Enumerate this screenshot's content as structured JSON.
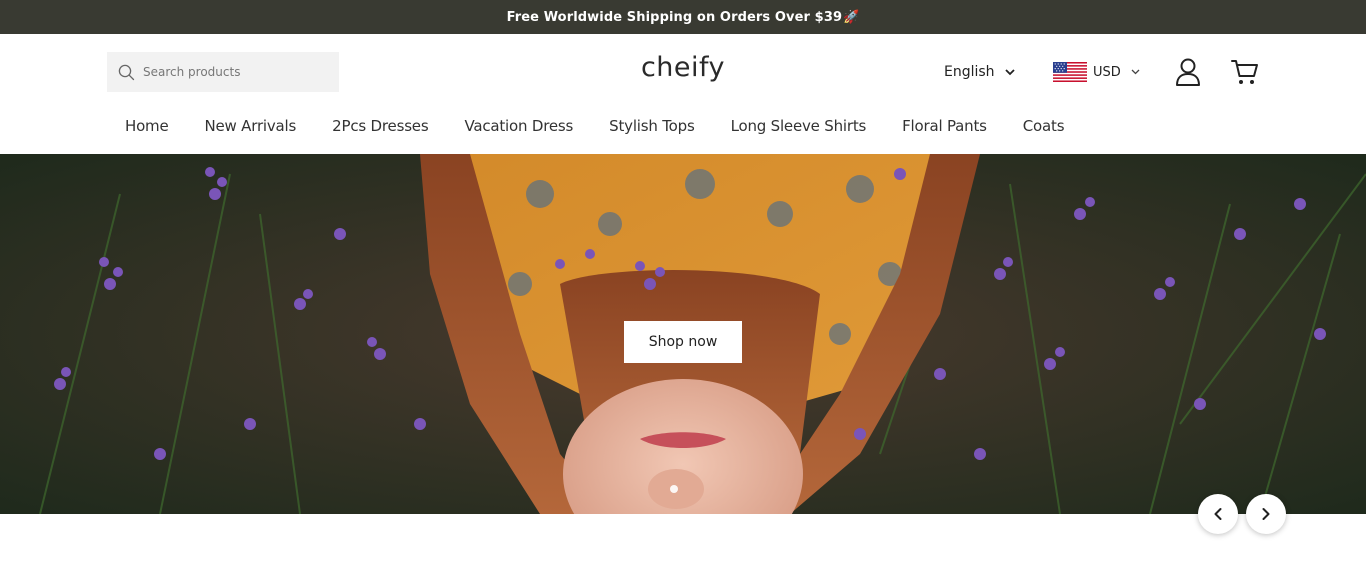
{
  "announcement": {
    "text": "Free Worldwide Shipping on Orders Over $39",
    "emoji": "🚀"
  },
  "header": {
    "search_placeholder": "Search products",
    "logo": "cheify",
    "language": "English",
    "currency": "USD"
  },
  "nav": {
    "items": [
      "Home",
      "New Arrivals",
      "2Pcs Dresses",
      "Vacation Dress",
      "Stylish Tops",
      "Long Sleeve Shirts",
      "Floral Pants",
      "Coats"
    ]
  },
  "hero": {
    "cta_label": "Shop now",
    "slide_count": 1,
    "active_slide": 1
  },
  "icons": {
    "search": "search-icon",
    "language_chevron": "chevron-down-icon",
    "flag": "us-flag-icon",
    "account": "user-icon",
    "cart": "cart-icon",
    "prev": "chevron-left-icon",
    "next": "chevron-right-icon"
  },
  "colors": {
    "announcement_bg": "#393a32",
    "search_bg": "#f2f2f2",
    "text": "#222222"
  }
}
